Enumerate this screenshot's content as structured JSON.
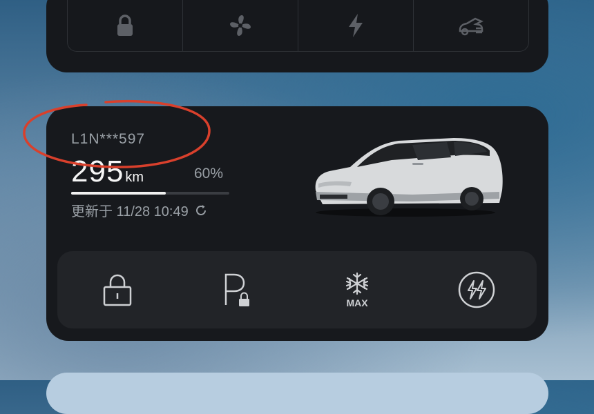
{
  "top_widget": {
    "buttons": [
      {
        "icon": "lock-icon"
      },
      {
        "icon": "fan-icon"
      },
      {
        "icon": "lightning-icon"
      },
      {
        "icon": "trunk-icon"
      }
    ]
  },
  "vehicle": {
    "plate": "L1N***597",
    "range_value": "295",
    "range_unit": "km",
    "battery_percent": "60%",
    "battery_fraction": 0.6,
    "updated_text": "更新于 11/28 10:49"
  },
  "controls": [
    {
      "icon": "lock-icon"
    },
    {
      "icon": "parking-lock-icon"
    },
    {
      "icon": "defrost-max-icon",
      "label": "MAX"
    },
    {
      "icon": "charging-icon"
    }
  ],
  "colors": {
    "annotation": "#d9402c",
    "card_bg": "#17191d",
    "control_bg": "#222428",
    "icon": "#cfd1d4"
  }
}
